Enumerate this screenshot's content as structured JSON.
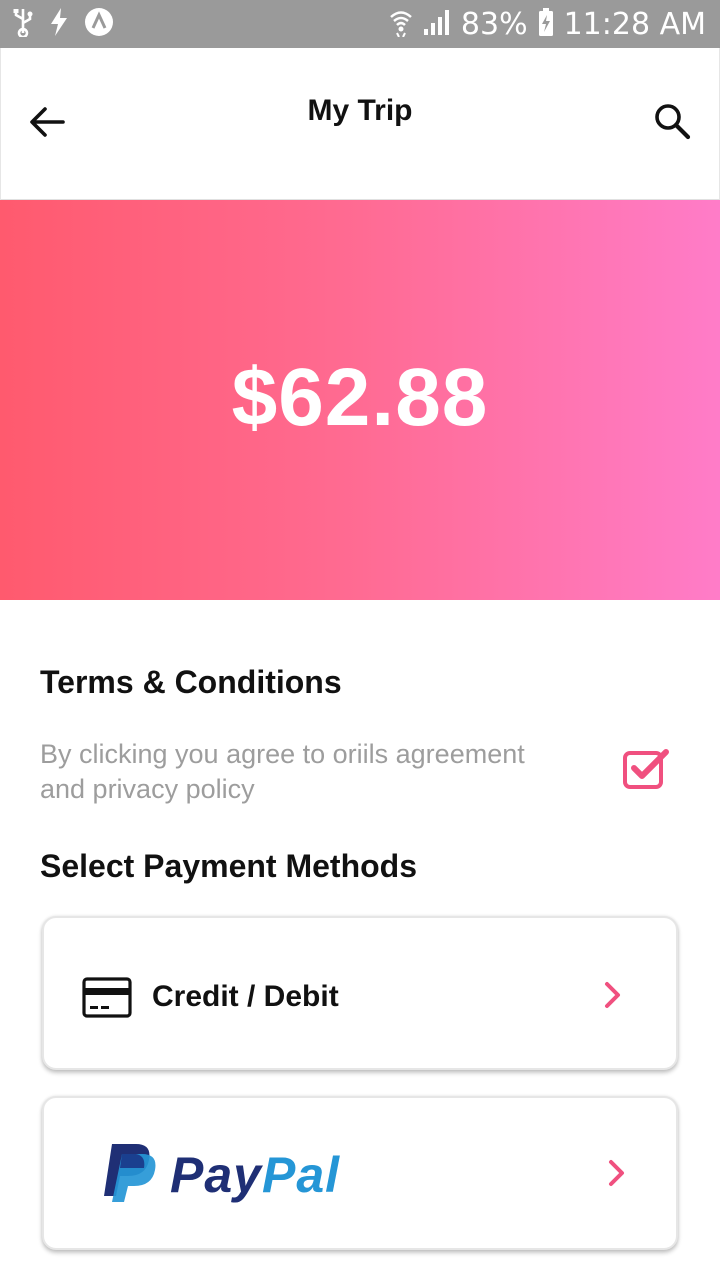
{
  "status_bar": {
    "battery": "83%",
    "time": "11:28 AM",
    "icons": [
      "usb-icon",
      "flash-icon",
      "app-notification-icon",
      "wifi-icon",
      "signal-icon",
      "battery-charging-icon"
    ]
  },
  "header": {
    "title": "My Trip",
    "back_icon": "arrow-left-icon",
    "search_icon": "search-icon"
  },
  "hero": {
    "amount": "$62.88",
    "gradient_start": "#ff5a6e",
    "gradient_end": "#ff7cc8"
  },
  "terms": {
    "title": "Terms & Conditions",
    "text": "By clicking you agree to oriils agreement and privacy policy",
    "checked": true,
    "accent": "#f0507f"
  },
  "payment": {
    "title": "Select Payment Methods",
    "methods": [
      {
        "label": "Credit / Debit",
        "icon": "credit-card-icon"
      },
      {
        "label_part1": "Pay",
        "label_part2": "Pal",
        "icon": "paypal-logo"
      }
    ]
  }
}
